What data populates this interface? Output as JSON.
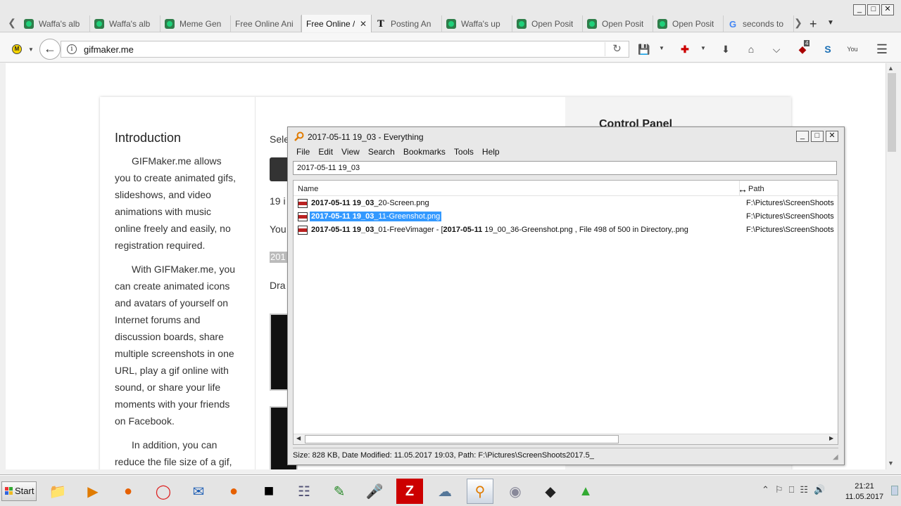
{
  "browser": {
    "tabs": [
      {
        "label": "Waffa's alb",
        "favicon": "imgur-icon",
        "active": false
      },
      {
        "label": "Waffa's alb",
        "favicon": "imgur-icon",
        "active": false
      },
      {
        "label": "Meme Gen",
        "favicon": "imgur-icon",
        "active": false
      },
      {
        "label": "Free Online Ani",
        "favicon": "none",
        "active": false
      },
      {
        "label": "Free Online /",
        "favicon": "none",
        "active": true
      },
      {
        "label": "Posting An",
        "favicon": "nyt-icon",
        "active": false
      },
      {
        "label": "Waffa's up",
        "favicon": "imgur-icon",
        "active": false
      },
      {
        "label": "Open Posit",
        "favicon": "imgur-icon",
        "active": false
      },
      {
        "label": "Open Posit",
        "favicon": "imgur-icon",
        "active": false
      },
      {
        "label": "Open Posit",
        "favicon": "imgur-icon",
        "active": false
      },
      {
        "label": "seconds to",
        "favicon": "google-icon",
        "active": false
      }
    ],
    "url": "gifmaker.me",
    "ublock_badge": "4"
  },
  "page": {
    "intro_title": "Introduction",
    "intro_paragraphs": [
      "GIFMaker.me allows you to create animated gifs, slideshows, and video animations with music online freely and easily, no registration required.",
      "With GIFMaker.me, you can create animated icons and avatars of yourself on Internet forums and discussion boards, share multiple screenshots in one URL, play a gif online with sound, or share your life moments with your friends on Facebook.",
      "In addition, you can reduce the file size of a gif,"
    ],
    "mid_texts": [
      "Sele",
      "19 i",
      "You",
      "201",
      "Dra"
    ],
    "right_title": "Control Panel"
  },
  "everything": {
    "title": "2017-05-11 19_03 - Everything",
    "menu": [
      "File",
      "Edit",
      "View",
      "Search",
      "Bookmarks",
      "Tools",
      "Help"
    ],
    "search_value": "2017-05-11 19_03",
    "columns": {
      "name": "Name",
      "path": "Path"
    },
    "results": [
      {
        "match": "2017-05-11 19_03",
        "rest": "_20-Screen.png",
        "extra_match": "",
        "extra_rest": "",
        "path": "F:\\Pictures\\ScreenShoots",
        "selected": false
      },
      {
        "match": "2017-05-11 19_03",
        "rest": "_11-Greenshot.png",
        "extra_match": "",
        "extra_rest": "",
        "path": "F:\\Pictures\\ScreenShoots",
        "selected": true
      },
      {
        "match": "2017-05-11 19_03",
        "rest": "_01-FreeVimager - [",
        "extra_match": "2017-05-11",
        "extra_rest": " 19_00_36-Greenshot.png , File 498 of 500 in Directory,.png",
        "path": "F:\\Pictures\\ScreenShoots",
        "selected": false
      }
    ],
    "status": "Size: 828 KB, Date Modified: 11.05.2017 19:03, Path: F:\\Pictures\\ScreenShoots2017.5_"
  },
  "taskbar": {
    "start_label": "Start",
    "time": "21:21",
    "date": "11.05.2017",
    "apps": [
      "file-manager-icon",
      "media-player-icon",
      "firefox-icon",
      "opera-icon",
      "thunderbird-icon",
      "firefox-icon",
      "cmd-icon",
      "calculator-icon",
      "notepad-icon",
      "microphone-icon",
      "filezilla-icon",
      "network-icon",
      "everything-search-icon",
      "disc-icon",
      "recorder-icon",
      "paint-icon"
    ]
  },
  "colors": {
    "selection": "#3399ff",
    "accent_green": "#2f7d4a"
  }
}
